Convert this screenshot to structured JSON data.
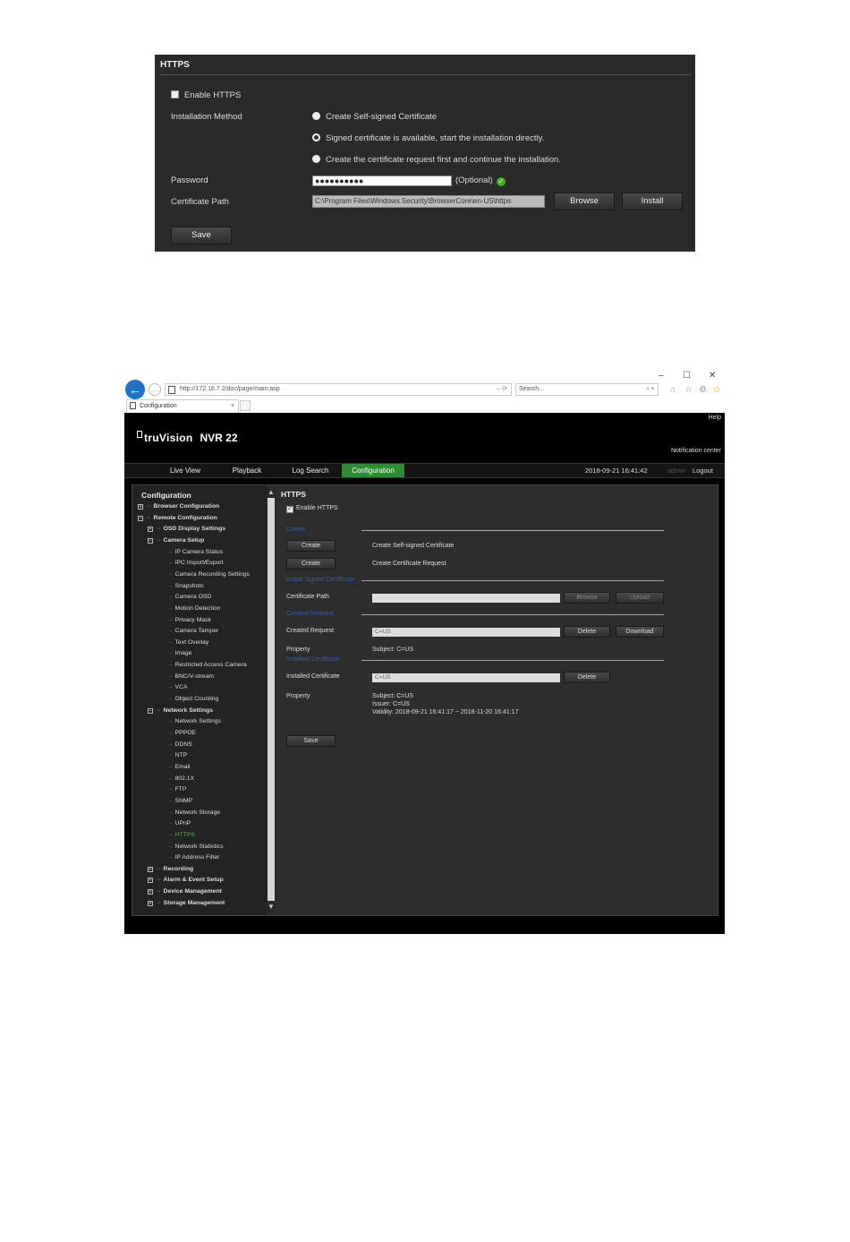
{
  "panel1": {
    "title": "HTTPS",
    "enable_label": "Enable HTTPS",
    "installation_method_label": "Installation Method",
    "options": [
      "Create Self-signed Certificate",
      "Signed certificate is available, start the installation directly.",
      "Create the certificate request first and continue the installation."
    ],
    "password_label": "Password",
    "password_value": "●●●●●●●●●●",
    "optional_label": "(Optional)",
    "cert_path_label": "Certificate Path",
    "cert_path_value": "C:\\Program Files\\Windows Security\\BrowserCore\\en-US\\https",
    "browse_label": "Browse",
    "install_label": "Install",
    "save_label": "Save"
  },
  "browser": {
    "window_controls": [
      "–",
      "☐",
      "✕"
    ],
    "address": "http://172.16.7.2/doc/page/main.asp",
    "address_right": "– ⟳",
    "search_placeholder": "Search...",
    "search_icon": "⌕ ▾",
    "toolbar_icons": [
      "⌂",
      "☆",
      "⚙",
      "☺"
    ],
    "tab_title": "Configuration",
    "tab_close": "×"
  },
  "app": {
    "help": "Help",
    "logo_brand": "truVision",
    "logo_model": "NVR 22",
    "notification": "Notification center",
    "nav": [
      "Live View",
      "Playback",
      "Log Search",
      "Configuration"
    ],
    "datetime": "2018-09-21 16:41:42",
    "user": "admin",
    "logout": "Logout"
  },
  "sidebar": {
    "title": "Configuration",
    "items": [
      {
        "label": "Browser Configuration",
        "level": 0,
        "exp": "+",
        "bold": true
      },
      {
        "label": "Remote Configuration",
        "level": 0,
        "exp": "−",
        "bold": true
      },
      {
        "label": "OSD Display Settings",
        "level": 1,
        "exp": "+",
        "bold": true
      },
      {
        "label": "Camera Setup",
        "level": 1,
        "exp": "−",
        "bold": true
      },
      {
        "label": "IP Camera Status",
        "level": 2
      },
      {
        "label": "IPC Import/Export",
        "level": 2
      },
      {
        "label": "Camera Recording Settings",
        "level": 2
      },
      {
        "label": "Snapshots",
        "level": 2
      },
      {
        "label": "Camera OSD",
        "level": 2
      },
      {
        "label": "Motion Detection",
        "level": 2
      },
      {
        "label": "Privacy Mask",
        "level": 2
      },
      {
        "label": "Camera Tamper",
        "level": 2
      },
      {
        "label": "Text Overlay",
        "level": 2
      },
      {
        "label": "Image",
        "level": 2
      },
      {
        "label": "Restricted Access Camera",
        "level": 2
      },
      {
        "label": "BNC/V-stream",
        "level": 2
      },
      {
        "label": "VCA",
        "level": 2
      },
      {
        "label": "Object Counting",
        "level": 2
      },
      {
        "label": "Network Settings",
        "level": 1,
        "exp": "−",
        "bold": true
      },
      {
        "label": "Network Settings",
        "level": 2
      },
      {
        "label": "PPPOE",
        "level": 2
      },
      {
        "label": "DDNS",
        "level": 2
      },
      {
        "label": "NTP",
        "level": 2
      },
      {
        "label": "Email",
        "level": 2
      },
      {
        "label": "802.1X",
        "level": 2
      },
      {
        "label": "FTP",
        "level": 2
      },
      {
        "label": "SNMP",
        "level": 2
      },
      {
        "label": "Network Storage",
        "level": 2
      },
      {
        "label": "UPnP",
        "level": 2
      },
      {
        "label": "HTTPS",
        "level": 2,
        "active": true
      },
      {
        "label": "Network Statistics",
        "level": 2
      },
      {
        "label": "IP Address Filter",
        "level": 2
      },
      {
        "label": "Recording",
        "level": 1,
        "exp": "+",
        "bold": true
      },
      {
        "label": "Alarm & Event Setup",
        "level": 1,
        "exp": "+",
        "bold": true
      },
      {
        "label": "Device Management",
        "level": 1,
        "exp": "+",
        "bold": true
      },
      {
        "label": "Storage Management",
        "level": 1,
        "exp": "+",
        "bold": true
      }
    ],
    "scroll_up": "▲",
    "scroll_down": "▼"
  },
  "main": {
    "title": "HTTPS",
    "enable_label": "Enable HTTPS",
    "check_mark": "✓",
    "sec_create": "Create",
    "create_btn_1": "Create",
    "create_desc_1": "Create Self-signed Certificate",
    "create_btn_2": "Create",
    "create_desc_2": "Create Certificate Request",
    "sec_install": "Install Signed Certificate",
    "cert_path_label": "Certificate Path",
    "browse_label": "Browse",
    "upload_label": "Upload",
    "sec_created": "Created Request",
    "created_request_label": "Created Request",
    "created_request_value": "C=US",
    "delete_label_1": "Delete",
    "download_label": "Download",
    "property_label_1": "Property",
    "property_value_1": "Subject: C=US",
    "sec_installed": "Installed Certificate",
    "installed_cert_label": "Installed Certificate",
    "installed_cert_value": "C=US",
    "delete_label_2": "Delete",
    "property_label_2": "Property",
    "installed_subject": "Subject: C=US",
    "installed_issuer": "Issuer: C=US",
    "installed_validity": "Validity: 2018-09-21 16:41:17 ~ 2018-11-20 16:41:17",
    "save_label": "Save"
  }
}
